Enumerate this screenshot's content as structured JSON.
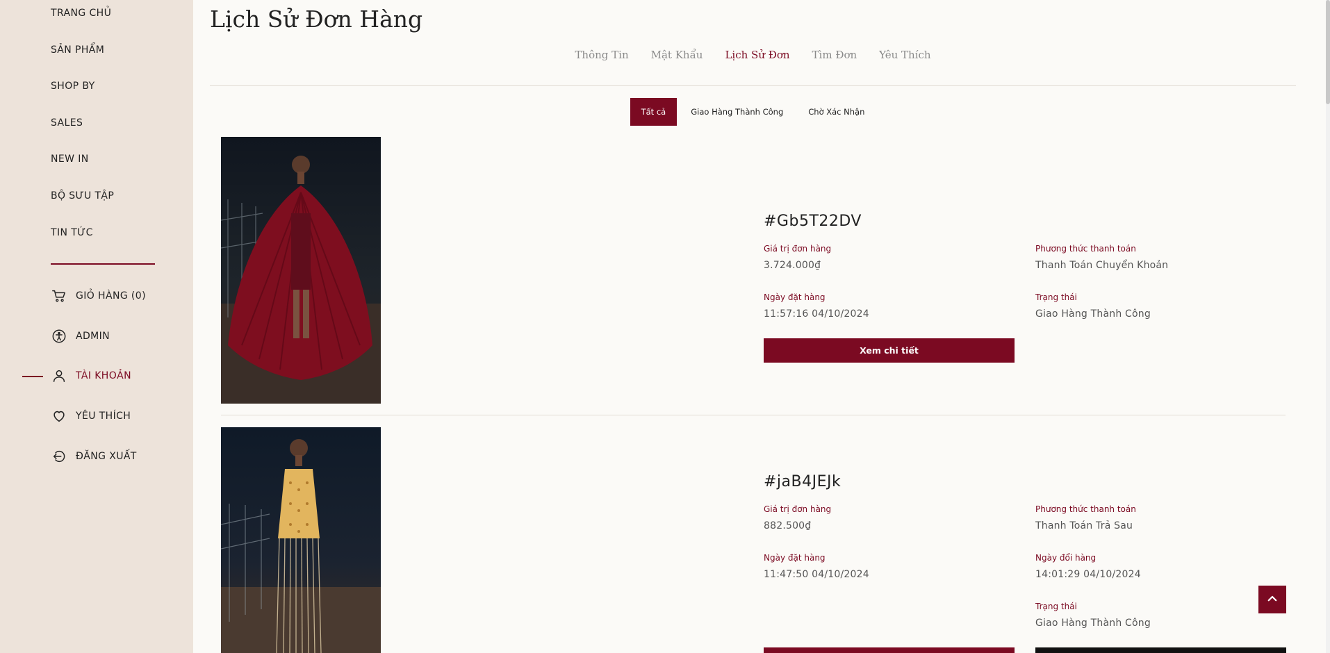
{
  "sidebar": {
    "nav": [
      "TRANG CHỦ",
      "SẢN PHẨM",
      "SHOP BY",
      "SALES",
      "NEW IN",
      "BỘ SƯU TẬP",
      "TIN TỨC"
    ],
    "account": [
      {
        "label": "GIỎ HÀNG (0)",
        "icon": "cart-icon"
      },
      {
        "label": "ADMIN",
        "icon": "accessibility-icon"
      },
      {
        "label": "TÀI KHOẢN",
        "icon": "user-icon",
        "active": true
      },
      {
        "label": "YÊU THÍCH",
        "icon": "heart-icon"
      },
      {
        "label": "ĐĂNG XUẤT",
        "icon": "logout-icon"
      }
    ]
  },
  "page": {
    "title": "Lịch Sử Đơn Hàng"
  },
  "tabs": [
    "Thông Tin",
    "Mật Khẩu",
    "Lịch Sử Đơn",
    "Tìm Đơn",
    "Yêu Thích"
  ],
  "active_tab": "Lịch Sử Đơn",
  "filters": [
    "Tất cả",
    "Giao Hàng Thành Công",
    "Chờ Xác Nhận"
  ],
  "active_filter": "Tất cả",
  "orders": [
    {
      "id": "#Gb5T22DV",
      "value_label": "Giá trị đơn hàng",
      "value": "3.724.000₫",
      "payment_label": "Phương thức thanh toán",
      "payment": "Thanh Toán Chuyển Khoản",
      "date_label": "Ngày đặt hàng",
      "date": "11:57:16 04/10/2024",
      "status_label": "Trạng thái",
      "status": "Giao Hàng Thành Công",
      "button": "Xem chi tiết"
    },
    {
      "id": "#jaB4JEJk",
      "value_label": "Giá trị đơn hàng",
      "value": "882.500₫",
      "payment_label": "Phương thức thanh toán",
      "payment": "Thanh Toán Trả Sau",
      "date_label": "Ngày đặt hàng",
      "date": "11:47:50 04/10/2024",
      "exchange_label": "Ngày đổi hàng",
      "exchange": "14:01:29 04/10/2024",
      "status_label": "Trạng thái",
      "status": "Giao Hàng Thành Công"
    }
  ],
  "colors": {
    "accent": "#7b0a22",
    "sidebar_bg": "#ede3da",
    "page_bg": "#fbfaf7"
  }
}
